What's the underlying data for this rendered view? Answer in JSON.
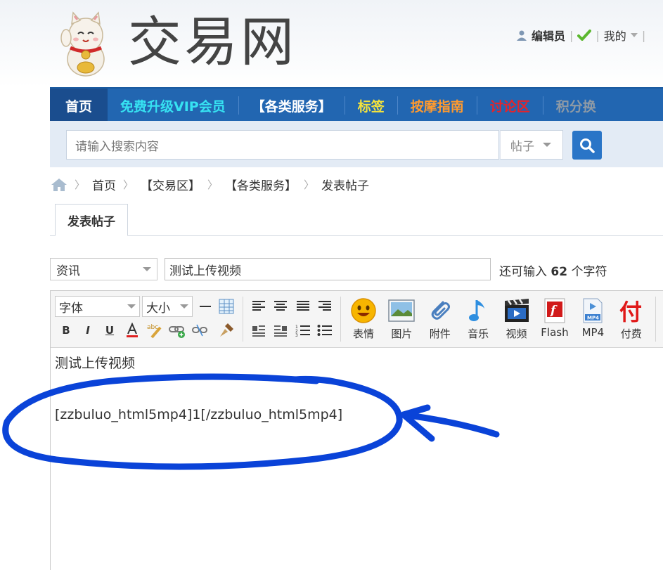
{
  "header": {
    "logo_text": "交易网",
    "user": {
      "name": "编辑员",
      "my_label": "我的"
    }
  },
  "nav": {
    "items": [
      {
        "label": "首页",
        "color": "#ffffff"
      },
      {
        "label": "免费升级VIP会员",
        "color": "#36e2f2"
      },
      {
        "label": "【各类服务】",
        "color": "#ffffff"
      },
      {
        "label": "标签",
        "color": "#f5e33c"
      },
      {
        "label": "按摩指南",
        "color": "#ff9a2e"
      },
      {
        "label": "讨论区",
        "color": "#e6232a"
      },
      {
        "label": "积分换",
        "color": "#8e9aa6"
      }
    ]
  },
  "search": {
    "placeholder": "请输入搜索内容",
    "scope": "帖子"
  },
  "breadcrumb": [
    "首页",
    "【交易区】",
    "【各类服务】",
    "发表帖子"
  ],
  "tab": {
    "label": "发表帖子"
  },
  "post_form": {
    "category": "资讯",
    "title_value": "测试上传视频",
    "remaining_prefix": "还可输入",
    "remaining_count": "62",
    "remaining_suffix": "个字符"
  },
  "toolbar": {
    "font_label": "字体",
    "size_label": "大小",
    "insert_buttons": [
      {
        "label": "表情",
        "icon": "emoji-icon"
      },
      {
        "label": "图片",
        "icon": "image-icon"
      },
      {
        "label": "附件",
        "icon": "paperclip-icon"
      },
      {
        "label": "音乐",
        "icon": "music-note-icon"
      },
      {
        "label": "视频",
        "icon": "video-icon"
      },
      {
        "label": "Flash",
        "icon": "flash-icon"
      },
      {
        "label": "MP4",
        "icon": "mp4-icon"
      },
      {
        "label": "付费",
        "icon": "paid-icon"
      }
    ]
  },
  "editor": {
    "line1": "测试上传视频",
    "line2": "[zzbuluo_html5mp4]1[/zzbuluo_html5mp4]"
  },
  "colors": {
    "nav_bg": "#2266b1",
    "nav_active_bg": "#1a4d8e",
    "annotation": "#0a43d8",
    "search_button": "#2a75c7"
  }
}
